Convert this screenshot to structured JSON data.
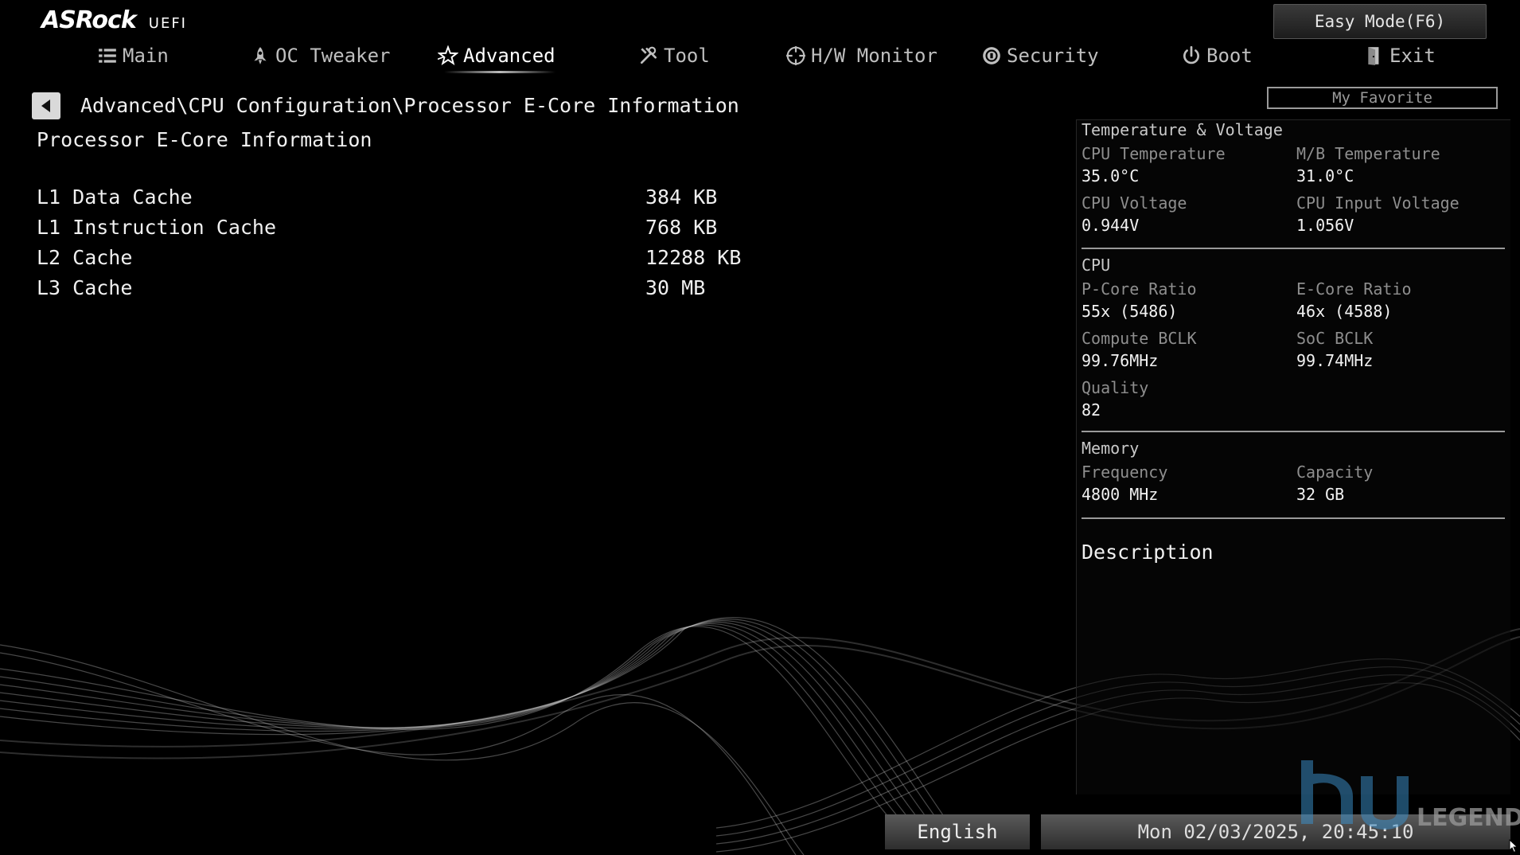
{
  "header": {
    "logo_main": "ASRock",
    "logo_sub": "UEFI",
    "easy_mode": "Easy Mode(F6)",
    "my_favorite": "My Favorite"
  },
  "tabs": [
    {
      "label": "Main",
      "icon": "list-icon"
    },
    {
      "label": "OC Tweaker",
      "icon": "rocket-icon"
    },
    {
      "label": "Advanced",
      "icon": "star-icon",
      "active": true
    },
    {
      "label": "Tool",
      "icon": "wrench-icon"
    },
    {
      "label": "H/W Monitor",
      "icon": "crosshair-icon"
    },
    {
      "label": "Security",
      "icon": "shield-icon"
    },
    {
      "label": "Boot",
      "icon": "power-icon"
    },
    {
      "label": "Exit",
      "icon": "exit-door-icon"
    }
  ],
  "breadcrumb": "Advanced\\CPU Configuration\\Processor E-Core Information",
  "page_title": "Processor E-Core Information",
  "items": [
    {
      "label": "L1 Data Cache",
      "value": "384 KB"
    },
    {
      "label": "L1 Instruction Cache",
      "value": "768 KB"
    },
    {
      "label": "L2 Cache",
      "value": "12288 KB"
    },
    {
      "label": "L3 Cache",
      "value": "30 MB"
    }
  ],
  "sidebar": {
    "temp_voltage": {
      "title": "Temperature & Voltage",
      "cpu_temp_label": "CPU Temperature",
      "cpu_temp": "35.0°C",
      "mb_temp_label": "M/B Temperature",
      "mb_temp": "31.0°C",
      "cpu_volt_label": "CPU Voltage",
      "cpu_volt": "0.944V",
      "cpu_input_volt_label": "CPU Input Voltage",
      "cpu_input_volt": "1.056V"
    },
    "cpu": {
      "title": "CPU",
      "pcore_label": "P-Core Ratio",
      "pcore": "55x (5486)",
      "ecore_label": "E-Core Ratio",
      "ecore": "46x (4588)",
      "compute_bclk_label": "Compute BCLK",
      "compute_bclk": "99.76MHz",
      "soc_bclk_label": "SoC BCLK",
      "soc_bclk": "99.74MHz",
      "quality_label": "Quality",
      "quality": "82"
    },
    "memory": {
      "title": "Memory",
      "freq_label": "Frequency",
      "freq": "4800 MHz",
      "capacity_label": "Capacity",
      "capacity": "32 GB"
    },
    "description_title": "Description"
  },
  "footer": {
    "language": "English",
    "datetime": "Mon 02/03/2025, 20:45:10"
  },
  "watermark": "LEGEND",
  "colors": {
    "background": "#000000",
    "text": "#f0f0f0",
    "muted": "#8e8e8e",
    "button": "#3a3a3a"
  }
}
